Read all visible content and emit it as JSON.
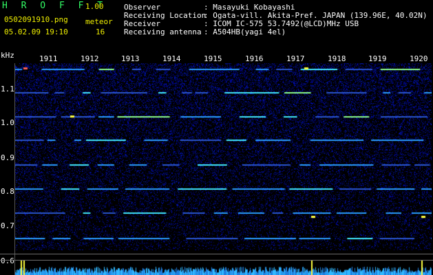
{
  "brand": {
    "name": "H R O F F T",
    "version": "1.00"
  },
  "file": {
    "name": "0502091910.png",
    "datetime": "05.02.09 19:10"
  },
  "meteor": {
    "label": "meteor",
    "count": "16"
  },
  "info": [
    {
      "label": "Observer",
      "value": ": Masayuki Kobayashi"
    },
    {
      "label": "Receiving Location",
      "value": ": Ogata-vill. Akita-Pref. JAPAN (139.96E, 40.02N)"
    },
    {
      "label": "Receiver",
      "value": ": ICOM IC-575 53.7492(@LCD)MHz USB"
    },
    {
      "label": "Receiving antenna",
      "value": ": A504HB(yagi 4el)"
    }
  ],
  "y_axis": {
    "unit": "kHz",
    "ticks": [
      "1.1",
      "1.0",
      "0.9",
      "0.8",
      "0.7",
      "0.6"
    ]
  },
  "x_axis": {
    "ticks": [
      "1911",
      "1912",
      "1913",
      "1914",
      "1915",
      "1916",
      "1917",
      "1918",
      "1919",
      "1920"
    ]
  },
  "colors": {
    "background": "#000000",
    "label_yellow": "#f0f000",
    "brand_green": "#33ff66",
    "noise_blue": "#1a1aa0",
    "line_cyan": "#30d0ff",
    "meteor_yellow": "#ffff40"
  }
}
